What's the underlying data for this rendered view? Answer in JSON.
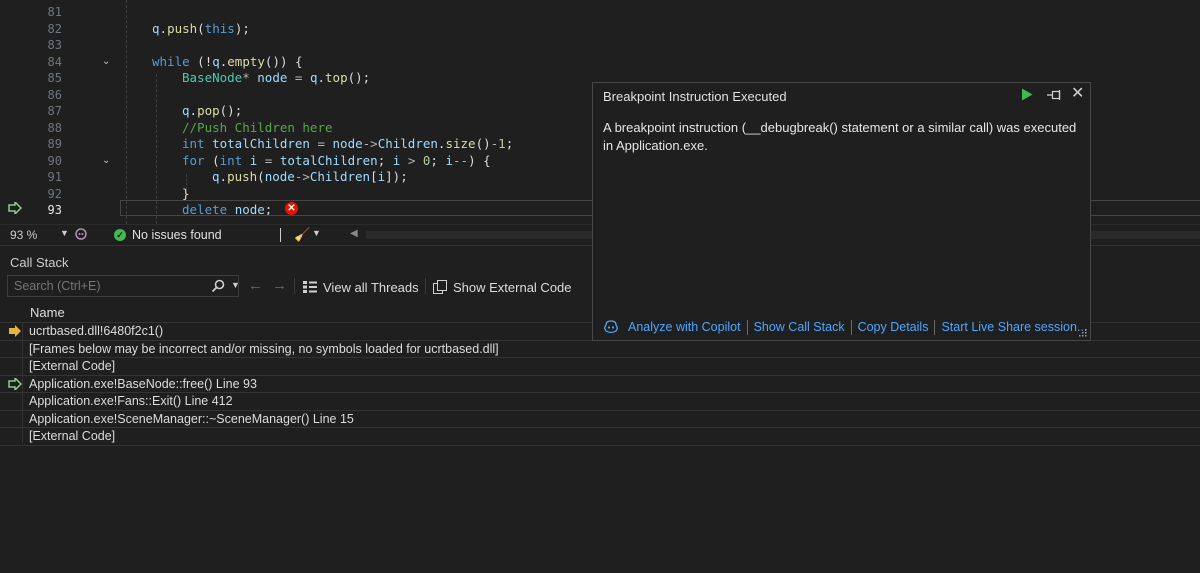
{
  "editor": {
    "lines": [
      {
        "num": "81",
        "indent": 0,
        "segments": []
      },
      {
        "num": "82",
        "indent": 1,
        "segments": [
          [
            "var",
            "q"
          ],
          [
            "pl",
            "."
          ],
          [
            "fn",
            "push"
          ],
          [
            "pl",
            "("
          ],
          [
            "kw",
            "this"
          ],
          [
            "pl",
            ");"
          ]
        ]
      },
      {
        "num": "83",
        "indent": 0,
        "segments": []
      },
      {
        "num": "84",
        "indent": 1,
        "fold": true,
        "segments": [
          [
            "kw",
            "while"
          ],
          [
            "pl",
            " (!"
          ],
          [
            "var",
            "q"
          ],
          [
            "pl",
            "."
          ],
          [
            "fn",
            "empty"
          ],
          [
            "pl",
            "()) {"
          ]
        ]
      },
      {
        "num": "85",
        "indent": 2,
        "segments": [
          [
            "ty",
            "BaseNode"
          ],
          [
            "op",
            "*"
          ],
          [
            "pl",
            " "
          ],
          [
            "var",
            "node"
          ],
          [
            "op",
            " = "
          ],
          [
            "var",
            "q"
          ],
          [
            "pl",
            "."
          ],
          [
            "fn",
            "top"
          ],
          [
            "pl",
            "();"
          ]
        ]
      },
      {
        "num": "86",
        "indent": 0,
        "segments": []
      },
      {
        "num": "87",
        "indent": 2,
        "segments": [
          [
            "var",
            "q"
          ],
          [
            "pl",
            "."
          ],
          [
            "fn",
            "pop"
          ],
          [
            "pl",
            "();"
          ]
        ]
      },
      {
        "num": "88",
        "indent": 2,
        "segments": [
          [
            "cm",
            "//Push Children here"
          ]
        ]
      },
      {
        "num": "89",
        "indent": 2,
        "segments": [
          [
            "kw",
            "int"
          ],
          [
            "pl",
            " "
          ],
          [
            "var",
            "totalChildren"
          ],
          [
            "op",
            " = "
          ],
          [
            "var",
            "node"
          ],
          [
            "op",
            "->"
          ],
          [
            "var",
            "Children"
          ],
          [
            "pl",
            "."
          ],
          [
            "fn",
            "size"
          ],
          [
            "pl",
            "()"
          ],
          [
            "op",
            "-"
          ],
          [
            "num",
            "1"
          ],
          [
            "pl",
            ";"
          ]
        ]
      },
      {
        "num": "90",
        "indent": 2,
        "fold": true,
        "segments": [
          [
            "kw",
            "for"
          ],
          [
            "pl",
            " ("
          ],
          [
            "kw",
            "int"
          ],
          [
            "pl",
            " "
          ],
          [
            "var",
            "i"
          ],
          [
            "op",
            " = "
          ],
          [
            "var",
            "totalChildren"
          ],
          [
            "pl",
            "; "
          ],
          [
            "var",
            "i"
          ],
          [
            "op",
            " > "
          ],
          [
            "num",
            "0"
          ],
          [
            "pl",
            "; "
          ],
          [
            "var",
            "i"
          ],
          [
            "op",
            "--"
          ],
          [
            "pl",
            ") {"
          ]
        ]
      },
      {
        "num": "91",
        "indent": 3,
        "segments": [
          [
            "var",
            "q"
          ],
          [
            "pl",
            "."
          ],
          [
            "fn",
            "push"
          ],
          [
            "pl",
            "("
          ],
          [
            "var",
            "node"
          ],
          [
            "op",
            "->"
          ],
          [
            "var",
            "Children"
          ],
          [
            "pl",
            "["
          ],
          [
            "var",
            "i"
          ],
          [
            "pl",
            "]);"
          ]
        ]
      },
      {
        "num": "92",
        "indent": 2,
        "segments": [
          [
            "pl",
            "}"
          ]
        ]
      },
      {
        "num": "93",
        "indent": 2,
        "current": true,
        "segments": [
          [
            "kw",
            "delete"
          ],
          [
            "pl",
            " "
          ],
          [
            "var",
            "node"
          ],
          [
            "pl",
            ";"
          ]
        ]
      }
    ]
  },
  "status": {
    "zoom": "93 %",
    "issues": "No issues found"
  },
  "callstack": {
    "title": "Call Stack",
    "search_placeholder": "Search (Ctrl+E)",
    "view_threads": "View all Threads",
    "show_external": "Show External Code",
    "column_name": "Name",
    "rows": [
      {
        "text": "ucrtbased.dll!6480f2c1()",
        "marker": "current"
      },
      {
        "text": "[Frames below may be incorrect and/or missing, no symbols loaded for ucrtbased.dll]",
        "marker": ""
      },
      {
        "text": "[External Code]",
        "marker": ""
      },
      {
        "text": "Application.exe!BaseNode::free() Line 93",
        "marker": "return"
      },
      {
        "text": "Application.exe!Fans::Exit() Line 412",
        "marker": ""
      },
      {
        "text": "Application.exe!SceneManager::~SceneManager() Line 15",
        "marker": ""
      },
      {
        "text": "[External Code]",
        "marker": ""
      }
    ]
  },
  "popup": {
    "title": "Breakpoint Instruction Executed",
    "message": "A breakpoint instruction (__debugbreak() statement or a similar call) was executed in Application.exe.",
    "links": [
      "Analyze with Copilot",
      "Show Call Stack",
      "Copy Details",
      "Start Live Share session..."
    ]
  },
  "colors": {
    "accent_link": "#4ca6ff",
    "continue_green": "#3fb950",
    "error_red": "#e51400",
    "current_frame_arrow": "#e8b33a",
    "return_frame_arrow": "#89d185"
  }
}
